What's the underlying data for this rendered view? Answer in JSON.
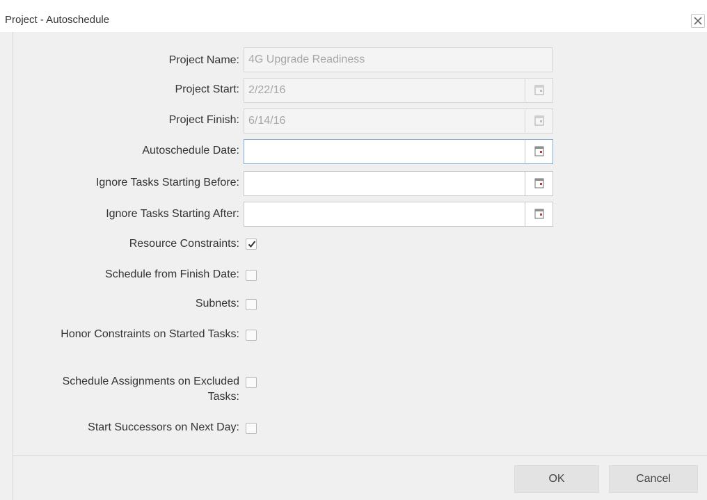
{
  "dialog": {
    "title": "Project - Autoschedule",
    "close_icon": "close-icon"
  },
  "fields": {
    "project_name": {
      "label": "Project Name:",
      "value": "4G Upgrade Readiness"
    },
    "project_start": {
      "label": "Project Start:",
      "value": "2/22/16",
      "icon": "calendar-icon"
    },
    "project_finish": {
      "label": "Project Finish:",
      "value": "6/14/16",
      "icon": "calendar-icon"
    },
    "autoschedule_date": {
      "label": "Autoschedule Date:",
      "value": "",
      "icon": "calendar-icon"
    },
    "ignore_before": {
      "label": "Ignore Tasks Starting Before:",
      "value": "",
      "icon": "calendar-icon"
    },
    "ignore_after": {
      "label": "Ignore Tasks Starting After:",
      "value": "",
      "icon": "calendar-icon"
    }
  },
  "options": {
    "resource_constraints": {
      "label": "Resource Constraints:",
      "checked": true
    },
    "schedule_from_finish": {
      "label": "Schedule from Finish Date:",
      "checked": false
    },
    "subnets": {
      "label": "Subnets:",
      "checked": false
    },
    "honor_constraints": {
      "label": "Honor Constraints on Started Tasks:",
      "checked": false
    },
    "schedule_assignments": {
      "label": "Schedule Assignments on Excluded Tasks:",
      "checked": false
    },
    "start_successors": {
      "label": "Start Successors on Next Day:",
      "checked": false
    }
  },
  "buttons": {
    "ok": "OK",
    "cancel": "Cancel"
  },
  "colors": {
    "focus_border": "#7fa9d9",
    "calendar_accent": "#c0392b"
  }
}
